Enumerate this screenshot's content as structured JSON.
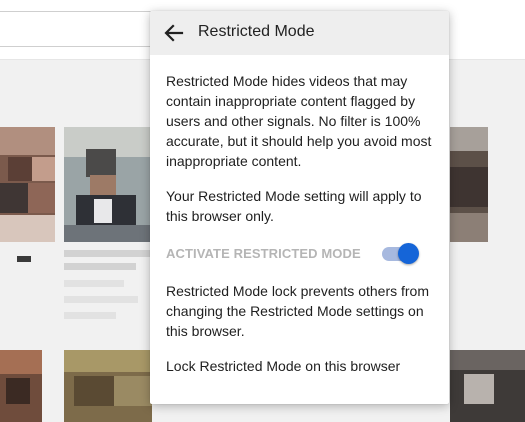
{
  "restricted_mode_menu": {
    "title": "Restricted Mode",
    "back_icon": "arrow-left-icon",
    "description": "Restricted Mode hides videos that may contain inappropriate content flagged by users and other signals. No filter is 100% accurate, but it should help you avoid most inappropriate content.",
    "browser_note": "Your Restricted Mode setting will apply to this browser only.",
    "activate_label": "ACTIVATE RESTRICTED MODE",
    "activate_state": "on",
    "lock_description": "Restricted Mode lock prevents others from changing the Restricted Mode settings on this browser.",
    "lock_link": "Lock Restricted Mode on this browser"
  },
  "colors": {
    "header_background": "#eeeeee",
    "toggle_knob": "#1565d8",
    "toggle_track": "#a7b9df",
    "disabled_label": "#b5b5b5"
  }
}
